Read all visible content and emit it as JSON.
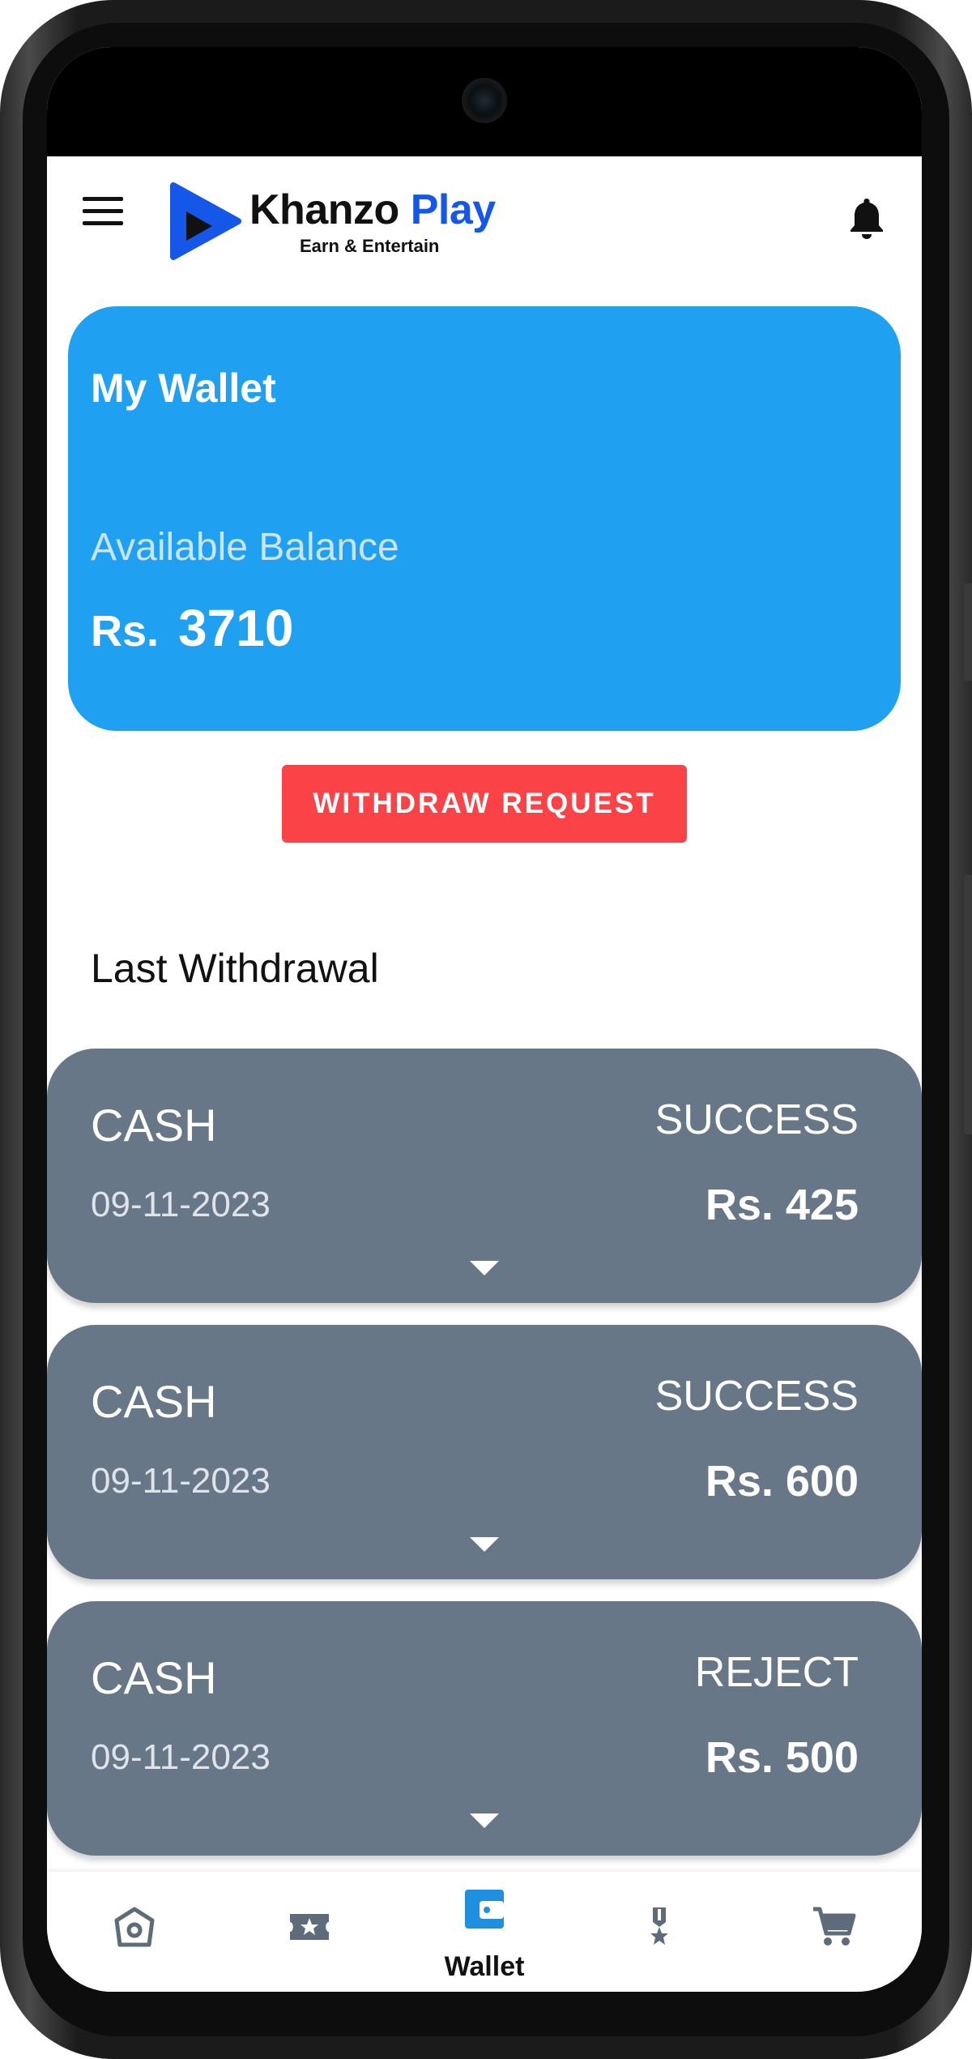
{
  "app": {
    "logo_name_part1": "Khanzo",
    "logo_name_part2": "Play",
    "logo_tagline": "Earn & Entertain",
    "brand_color": "#1557e8"
  },
  "wallet": {
    "title": "My Wallet",
    "balance_label": "Available Balance",
    "currency": "Rs.",
    "balance": "3710",
    "card_color": "#1fa0f0"
  },
  "actions": {
    "withdraw_label": "WITHDRAW REQUEST",
    "withdraw_color": "#fb4247"
  },
  "history": {
    "title": "Last Withdrawal",
    "items": [
      {
        "method": "CASH",
        "date": "09-11-2023",
        "status": "SUCCESS",
        "amount": "Rs. 425"
      },
      {
        "method": "CASH",
        "date": "09-11-2023",
        "status": "SUCCESS",
        "amount": "Rs. 600"
      },
      {
        "method": "CASH",
        "date": "09-11-2023",
        "status": "REJECT",
        "amount": "Rs. 500"
      }
    ]
  },
  "nav": {
    "items": [
      {
        "icon": "home-icon",
        "label": ""
      },
      {
        "icon": "ticket-icon",
        "label": ""
      },
      {
        "icon": "wallet-icon",
        "label": "Wallet",
        "active": true
      },
      {
        "icon": "medal-icon",
        "label": ""
      },
      {
        "icon": "cart-icon",
        "label": ""
      }
    ],
    "active_color": "#1f8fe0",
    "inactive_color": "#5d6b7a"
  }
}
